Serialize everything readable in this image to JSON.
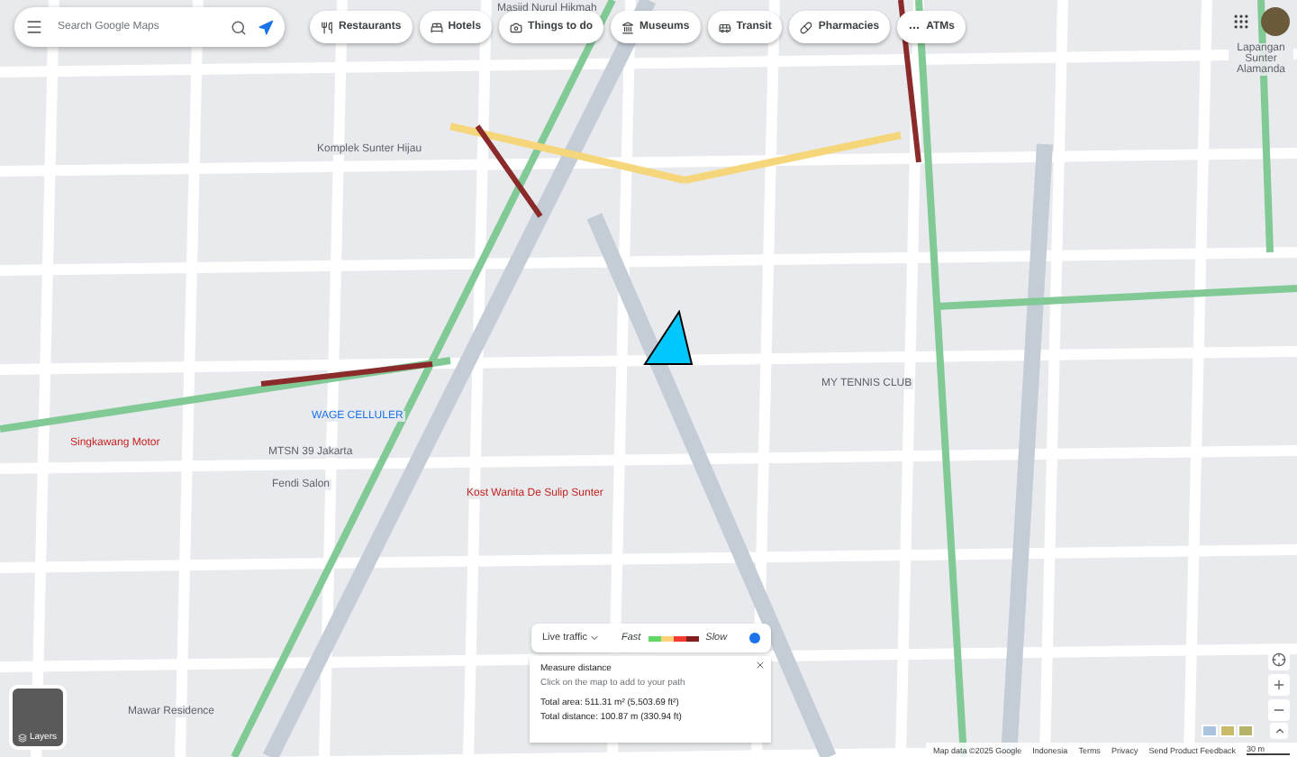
{
  "search": {
    "placeholder": "Search Google Maps"
  },
  "categories": [
    {
      "label": "Restaurants",
      "kind": "restaurant"
    },
    {
      "label": "Hotels",
      "kind": "hotel"
    },
    {
      "label": "Things to do",
      "kind": "camera"
    },
    {
      "label": "Museums",
      "kind": "museum"
    },
    {
      "label": "Transit",
      "kind": "transit"
    },
    {
      "label": "Pharmacies",
      "kind": "pharmacy"
    },
    {
      "label": "ATMs",
      "kind": "more"
    }
  ],
  "map_labels": [
    {
      "text": "Masjid Nurul Hikmah"
    },
    {
      "text": "Komplek Sunter Hijau"
    },
    {
      "text": "Singkawang Motor"
    },
    {
      "text": "WAGE CELLULER"
    },
    {
      "text": "MTSN 39 Jakarta"
    },
    {
      "text": "Fendi Salon"
    },
    {
      "text": "Kost Wanita De Sulip Sunter"
    },
    {
      "text": "Mawar Residence"
    },
    {
      "text": "MY TENNIS CLUB"
    },
    {
      "text": "Lapangan Sunter Alamanda"
    }
  ],
  "layers": {
    "label": "Layers"
  },
  "traffic": {
    "label": "Live traffic",
    "fast": "Fast",
    "slow": "Slow"
  },
  "measure": {
    "title": "Measure distance",
    "hint": "Click on the map to add to your path",
    "area": "Total area: 511.31 m² (5,503.69 ft²)",
    "distance": "Total distance: 100.87 m (330.94 ft)"
  },
  "footer": [
    "Map data ©2025 Google",
    "Indonesia",
    "Terms",
    "Privacy",
    "Send Product Feedback"
  ],
  "scale": "30 m"
}
